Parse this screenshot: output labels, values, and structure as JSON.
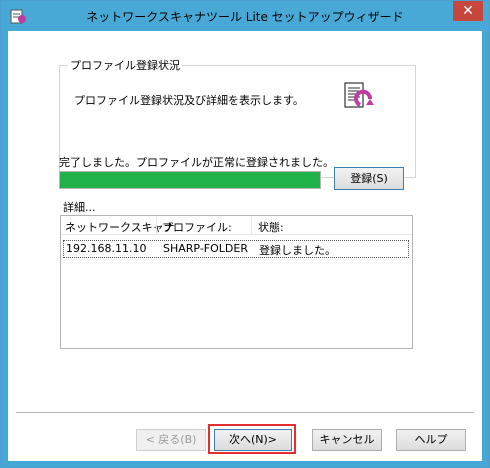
{
  "window": {
    "title": "ネットワークスキャナツール Lite セットアップウィザード",
    "close_label": "✕"
  },
  "group": {
    "title": "プロファイル登録状況",
    "description": "プロファイル登録状況及び詳細を表示します。"
  },
  "status": {
    "message": "完了しました。プロファイルが正常に登録されました。",
    "progress_percent": 100
  },
  "register_button": "登録(S)",
  "details": {
    "label": "詳細...",
    "columns": [
      "ネットワークスキャナ",
      "プロファイル:",
      "状態:"
    ],
    "rows": [
      {
        "scanner": "192.168.11.10",
        "profile": "SHARP-FOLDER",
        "state": "登録しました。"
      }
    ]
  },
  "buttons": {
    "back": "< 戻る(B)",
    "next": "次へ(N)>",
    "cancel": "キャンセル",
    "help": "ヘルプ"
  },
  "colors": {
    "progress": "#20b14b",
    "highlight": "#e23030",
    "titlebar": "#48a8d6"
  }
}
